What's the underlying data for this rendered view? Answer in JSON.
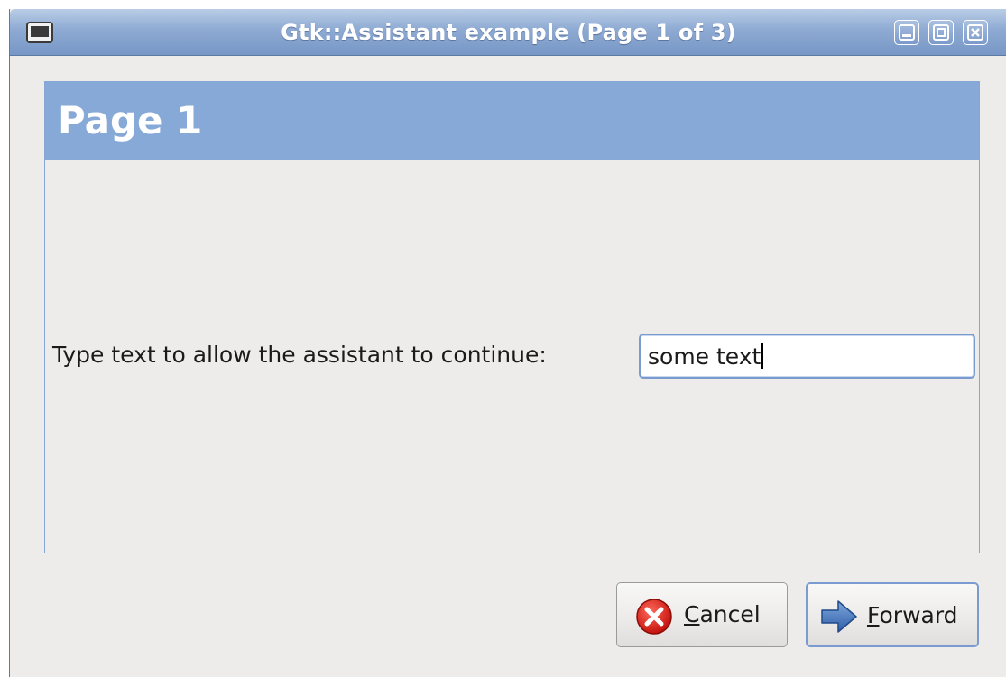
{
  "window": {
    "title": "Gtk::Assistant example (Page 1 of 3)",
    "controls": {
      "minimize_icon": "minimize-icon",
      "maximize_icon": "maximize-icon",
      "close_icon": "close-icon"
    },
    "accent_color": "#86a9d8"
  },
  "page": {
    "title": "Page 1",
    "prompt_label": "Type text to allow the assistant to continue:",
    "entry": {
      "value": "some text"
    }
  },
  "buttons": {
    "cancel": {
      "mnemonic": "C",
      "rest": "ancel",
      "icon": "cancel-icon"
    },
    "forward": {
      "mnemonic": "F",
      "rest": "orward",
      "icon": "forward-arrow-icon"
    }
  }
}
